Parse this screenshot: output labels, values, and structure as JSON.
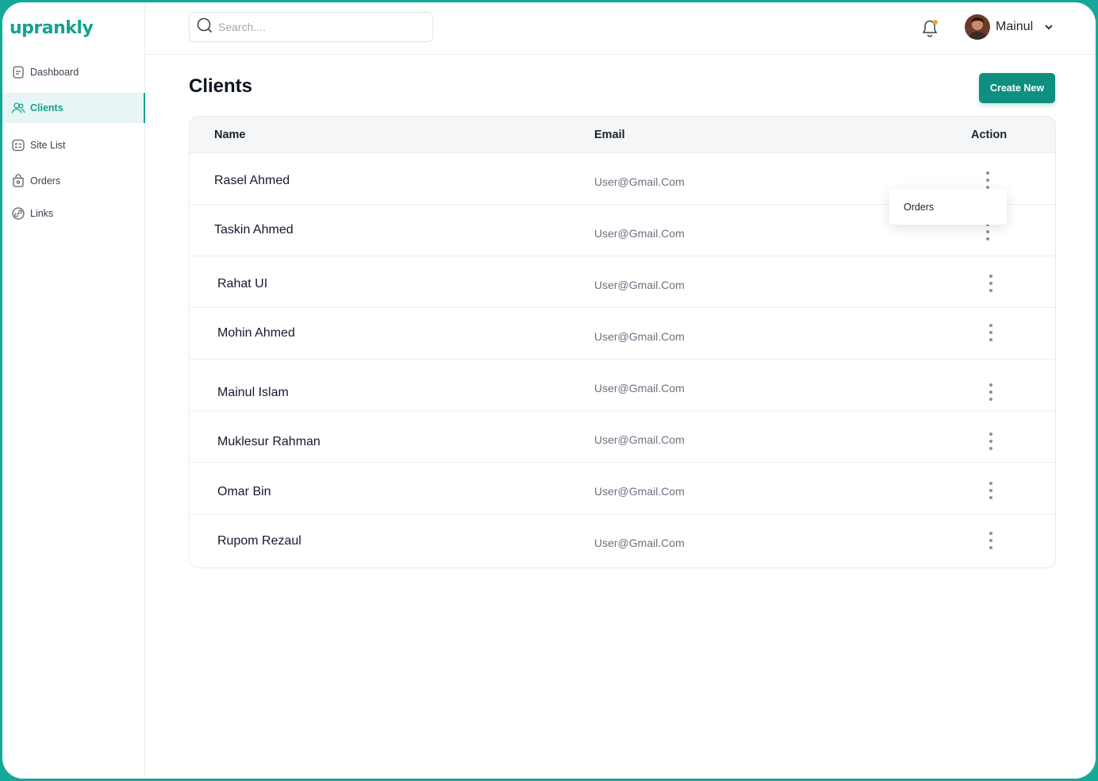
{
  "brand": {
    "logo": "uprankly",
    "accent": "#10a190"
  },
  "sidebar": {
    "items": [
      {
        "label": "Dashboard",
        "icon": "document-icon",
        "active": false
      },
      {
        "label": "Clients",
        "icon": "users-icon",
        "active": true
      },
      {
        "label": "Site List",
        "icon": "list-icon",
        "active": false
      },
      {
        "label": "Orders",
        "icon": "bag-icon",
        "active": false
      },
      {
        "label": "Links",
        "icon": "link-icon",
        "active": false
      }
    ]
  },
  "topbar": {
    "search_placeholder": "Search....",
    "notification_icon": "bell-icon",
    "user_name": "Mainul"
  },
  "page": {
    "title": "Clients",
    "create_label": "Create New"
  },
  "table": {
    "headers": {
      "name": "Name",
      "email": "Email",
      "action": "Action"
    },
    "rows": [
      {
        "name": "Rasel Ahmed",
        "email": "User@Gmail.Com"
      },
      {
        "name": "Taskin Ahmed",
        "email": "User@Gmail.Com"
      },
      {
        "name": "Rahat UI",
        "email": "User@Gmail.Com"
      },
      {
        "name": "Mohin Ahmed",
        "email": "User@Gmail.Com"
      },
      {
        "name": "Mainul Islam",
        "email": "User@Gmail.Com"
      },
      {
        "name": "Muklesur Rahman",
        "email": "User@Gmail.Com"
      },
      {
        "name": "Omar Bin",
        "email": "User@Gmail.Com"
      },
      {
        "name": "Rupom Rezaul",
        "email": "User@Gmail.Com"
      }
    ]
  },
  "dropdown": {
    "item_label": "Orders"
  }
}
